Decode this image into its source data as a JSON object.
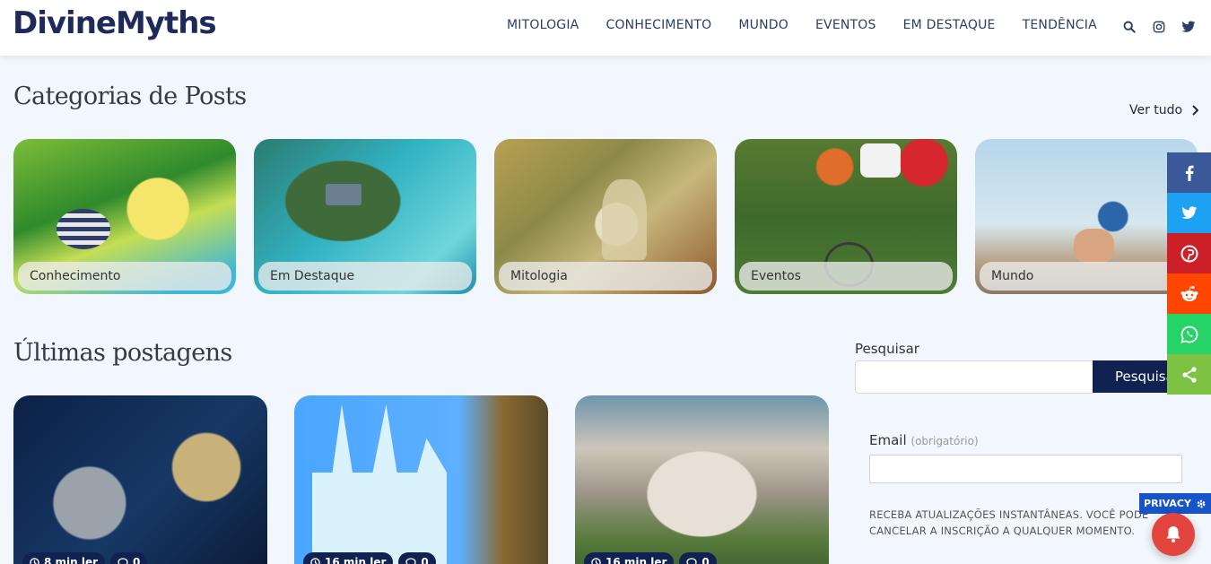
{
  "header": {
    "logo": "DivineMyths",
    "nav": [
      "MITOLOGIA",
      "CONHECIMENTO",
      "MUNDO",
      "EVENTOS",
      "EM DESTAQUE",
      "TENDÊNCIA"
    ],
    "icons": [
      "search-icon",
      "instagram-icon",
      "twitter-icon"
    ]
  },
  "categories": {
    "title": "Categorias de Posts",
    "see_all": "Ver tudo",
    "items": [
      "Conhecimento",
      "Em Destaque",
      "Mitologia",
      "Eventos",
      "Mundo"
    ]
  },
  "latest": {
    "title": "Últimas postagens",
    "posts": [
      {
        "read_time": "8 min ler",
        "comments": "0"
      },
      {
        "read_time": "16 min ler",
        "comments": "0"
      },
      {
        "read_time": "16 min ler",
        "comments": "0"
      }
    ]
  },
  "sidebar": {
    "search_label": "Pesquisar",
    "search_button": "Pesquisar",
    "email_label": "Email",
    "email_required": "(obrigatório)",
    "notice": "RECEBA ATUALIZAÇÕES INSTANTÂNEAS. VOCÊ PODE CANCELAR A INSCRIÇÃO A QUALQUER MOMENTO."
  },
  "share": {
    "buttons": [
      {
        "icon": "facebook-icon",
        "color": "#3b5998"
      },
      {
        "icon": "twitter-icon",
        "color": "#1da1f2"
      },
      {
        "icon": "pinterest-icon",
        "color": "#cb2027"
      },
      {
        "icon": "reddit-icon",
        "color": "#ff4500"
      },
      {
        "icon": "whatsapp-icon",
        "color": "#25d366"
      },
      {
        "icon": "share-icon",
        "color": "#7dc243"
      }
    ]
  },
  "privacy": {
    "label": "PRIVACY"
  },
  "colors": {
    "brand": "#1e2a5a",
    "accent": "#0f2250",
    "background": "#f1f7fc"
  }
}
